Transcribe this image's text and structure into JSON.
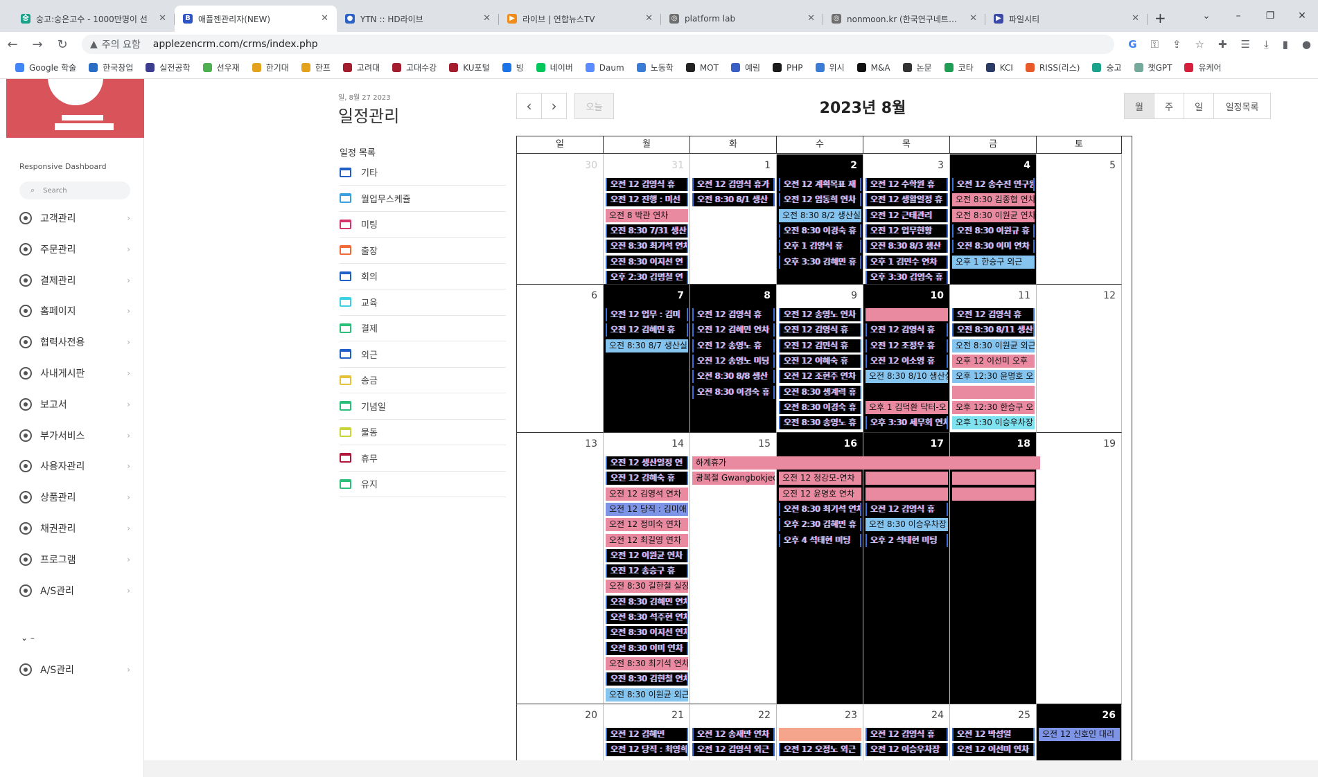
{
  "browser": {
    "tabs": [
      {
        "title": "숭고:숭은고수 - 1000만명이 선",
        "icon_color": "#1aa38b",
        "icon_glyph": "숭",
        "active": false
      },
      {
        "title": "애플젠관리자(NEW)",
        "icon_color": "#2e55c6",
        "icon_glyph": "B",
        "active": true
      },
      {
        "title": "YTN :: HD라이브",
        "icon_color": "#2a63c4",
        "icon_glyph": "●",
        "active": false
      },
      {
        "title": "라이브 | 연합뉴스TV",
        "icon_color": "#f08c1a",
        "icon_glyph": "▶",
        "active": false
      },
      {
        "title": "platform lab",
        "icon_color": "#6f6f6f",
        "icon_glyph": "◎",
        "active": false
      },
      {
        "title": "nonmoon.kr (한국연구네트워크",
        "icon_color": "#6f6f6f",
        "icon_glyph": "◎",
        "active": false
      },
      {
        "title": "파일시티",
        "icon_color": "#3b4aa7",
        "icon_glyph": "▶",
        "active": false
      }
    ],
    "new_tab": "+",
    "warning_text": "주의 요함",
    "url": "applezencrm.com/crms/index.php",
    "bookmarks": [
      {
        "label": "Google 학술",
        "color": "#4285f4"
      },
      {
        "label": "한국창업",
        "color": "#2b6cc4"
      },
      {
        "label": "실전공학",
        "color": "#3d3d8f"
      },
      {
        "label": "선우재",
        "color": "#4caf50"
      },
      {
        "label": "한기대",
        "color": "#e4a11b"
      },
      {
        "label": "한프",
        "color": "#e4a11b"
      },
      {
        "label": "고려대",
        "color": "#a31d2e"
      },
      {
        "label": "고대수강",
        "color": "#a31d2e"
      },
      {
        "label": "KU포털",
        "color": "#a31d2e"
      },
      {
        "label": "빙",
        "color": "#1b73e8"
      },
      {
        "label": "네이버",
        "color": "#03c75a"
      },
      {
        "label": "Daum",
        "color": "#5a8cff"
      },
      {
        "label": "노동학",
        "color": "#3a7bd5"
      },
      {
        "label": "MOT",
        "color": "#222222"
      },
      {
        "label": "예림",
        "color": "#3a5fc4"
      },
      {
        "label": "PHP",
        "color": "#1a1a1a"
      },
      {
        "label": "위시",
        "color": "#3a7bd5"
      },
      {
        "label": "M&A",
        "color": "#111111"
      },
      {
        "label": "논문",
        "color": "#333333"
      },
      {
        "label": "코타",
        "color": "#1f9d55"
      },
      {
        "label": "KCI",
        "color": "#2a3b66"
      },
      {
        "label": "RISS(리스)",
        "color": "#e85a2a"
      },
      {
        "label": "숭고",
        "color": "#1aa38b"
      },
      {
        "label": "챗GPT",
        "color": "#74aa9c"
      },
      {
        "label": "유케어",
        "color": "#d6203b"
      }
    ]
  },
  "sidebar": {
    "title": "Responsive Dashboard",
    "search_placeholder": "Search",
    "menu": [
      "고객관리",
      "주문관리",
      "결제관리",
      "홈페이지",
      "협력사전용",
      "사내게시판",
      "보고서",
      "부가서비스",
      "사용자관리",
      "상품관리",
      "채권관리",
      "프로그램",
      "A/S관리"
    ],
    "mini_row": "⌄        –",
    "extra_item": "A/S관리"
  },
  "page": {
    "date": "일, 8월 27 2023",
    "title": "일정관리",
    "category_title": "일정 목록",
    "categories": [
      {
        "label": "기타",
        "color": "#1f5fc7"
      },
      {
        "label": "월업무스케쥴",
        "color": "#3aa0e0"
      },
      {
        "label": "미팅",
        "color": "#d6336c"
      },
      {
        "label": "출장",
        "color": "#f06a3a"
      },
      {
        "label": "회의",
        "color": "#1f5fc7"
      },
      {
        "label": "교육",
        "color": "#3ad0e6"
      },
      {
        "label": "결제",
        "color": "#2cbf7a"
      },
      {
        "label": "외근",
        "color": "#1f5fc7"
      },
      {
        "label": "송금",
        "color": "#e6c23a"
      },
      {
        "label": "기념일",
        "color": "#2cbf7a"
      },
      {
        "label": "물동",
        "color": "#c8d43a"
      },
      {
        "label": "휴무",
        "color": "#b0173a"
      },
      {
        "label": "유지",
        "color": "#2cbf7a"
      }
    ]
  },
  "calendar": {
    "prev": "‹",
    "next": "›",
    "today": "오늘",
    "title": "2023년 8월",
    "views": [
      "월",
      "주",
      "일",
      "일정목록"
    ],
    "weekdays": [
      "일",
      "월",
      "화",
      "수",
      "목",
      "금",
      "토"
    ],
    "weeks": [
      {
        "days": [
          {
            "num": "30",
            "other": true,
            "dark": false,
            "events": []
          },
          {
            "num": "31",
            "other": true,
            "dark": false,
            "events": [
              {
                "text": "오전 12 김영식 휴",
                "style": "glitch"
              },
              {
                "text": "오전 12 진행 : 미선",
                "style": "glitch"
              },
              {
                "text": "오전 8 박관 연차",
                "style": "pink"
              },
              {
                "text": "오전 8:30 7/31 생산",
                "style": "glitch"
              },
              {
                "text": "오전 8:30 최기석 연차",
                "style": "glitch"
              },
              {
                "text": "오전 8:30 이지선 연",
                "style": "glitch"
              },
              {
                "text": "오후 2:30 김명철 연",
                "style": "glitch"
              }
            ]
          },
          {
            "num": "1",
            "other": false,
            "dark": false,
            "events": [
              {
                "text": "오전 12 김영식 휴가",
                "style": "glitch"
              },
              {
                "text": "오전 8:30 8/1 생산",
                "style": "glitch"
              }
            ]
          },
          {
            "num": "2",
            "other": false,
            "dark": true,
            "events": [
              {
                "text": "오전 12 계획목표 재",
                "style": "glitch"
              },
              {
                "text": "오전 12 임동희 연차",
                "style": "glitch"
              },
              {
                "text": "오전 8:30 8/2 생산실",
                "style": "blue"
              },
              {
                "text": "오전 8:30 이경숙 휴",
                "style": "glitch"
              },
              {
                "text": "오후 1 김영식 휴",
                "style": "glitch"
              },
              {
                "text": "오후 3:30 김혜민 휴",
                "style": "glitch"
              }
            ]
          },
          {
            "num": "3",
            "other": false,
            "dark": false,
            "events": [
              {
                "text": "오전 12 수학원 휴",
                "style": "glitch"
              },
              {
                "text": "오전 12 생활일정 휴",
                "style": "glitch"
              },
              {
                "text": "오전 12 근태관리",
                "style": "glitch"
              },
              {
                "text": "오전 12 업무현황",
                "style": "glitch"
              },
              {
                "text": "오전 8:30 8/3 생산",
                "style": "glitch"
              },
              {
                "text": "오후 1 김민수 연차",
                "style": "glitch"
              },
              {
                "text": "오후 3:30 김영숙 휴",
                "style": "glitch"
              }
            ]
          },
          {
            "num": "4",
            "other": false,
            "dark": true,
            "events": [
              {
                "text": "오전 12 송수진 연구원",
                "style": "glitch"
              },
              {
                "text": "오전 8:30 김종협 연차",
                "style": "pink"
              },
              {
                "text": "오전 8:30 이원균 연차",
                "style": "pink"
              },
              {
                "text": "오전 8:30 이원규 휴",
                "style": "glitch"
              },
              {
                "text": "오전 8:30 이미 연차",
                "style": "glitch"
              },
              {
                "text": "오후 1 한승구 외근",
                "style": "blue"
              }
            ]
          },
          {
            "num": "5",
            "other": false,
            "dark": false,
            "events": []
          }
        ]
      },
      {
        "days": [
          {
            "num": "6",
            "other": false,
            "dark": false,
            "events": []
          },
          {
            "num": "7",
            "other": false,
            "dark": true,
            "events": [
              {
                "text": "오전 12 업무 : 김미",
                "style": "glitch"
              },
              {
                "text": "오전 12 김혜민 휴",
                "style": "glitch"
              },
              {
                "text": "오전 8:30 8/7 생산실",
                "style": "blue"
              }
            ]
          },
          {
            "num": "8",
            "other": false,
            "dark": true,
            "events": [
              {
                "text": "오전 12 김영식 휴",
                "style": "glitch"
              },
              {
                "text": "오전 12 김혜민 연차",
                "style": "glitch"
              },
              {
                "text": "오전 12 송영노 휴",
                "style": "glitch"
              },
              {
                "text": "오전 12 송영노 미팅",
                "style": "glitch"
              },
              {
                "text": "오전 8:30 8/8 생산",
                "style": "glitch"
              },
              {
                "text": "오전 8:30 이경숙 휴",
                "style": "glitch"
              }
            ]
          },
          {
            "num": "9",
            "other": false,
            "dark": false,
            "events": [
              {
                "text": "오전 12 송영노 연차",
                "style": "glitch"
              },
              {
                "text": "오전 12 김영식 휴",
                "style": "glitch"
              },
              {
                "text": "오전 12 김민식 휴",
                "style": "glitch"
              },
              {
                "text": "오전 12 이혜숙 휴",
                "style": "glitch"
              },
              {
                "text": "오전 12 조현주 연차",
                "style": "glitch"
              },
              {
                "text": "오전 8:30 생계력 휴",
                "style": "glitch"
              },
              {
                "text": "오전 8:30 이경숙 휴",
                "style": "glitch"
              },
              {
                "text": "오전 8:30 송영노 휴",
                "style": "glitch"
              }
            ]
          },
          {
            "num": "10",
            "other": false,
            "dark": true,
            "events": [
              {
                "text": "",
                "style": "pink"
              },
              {
                "text": "오전 12 김영식 휴",
                "style": "glitch"
              },
              {
                "text": "오전 12 조정우 휴",
                "style": "glitch"
              },
              {
                "text": "오전 12 이소영 휴",
                "style": "glitch"
              },
              {
                "text": "오전 8:30 8/10 생산실",
                "style": "blue"
              },
              {
                "text": "",
                "style": "none"
              },
              {
                "text": "오후 1 김덕환 닥터-오",
                "style": "pink"
              },
              {
                "text": "오후 3:30 세무회 연차",
                "style": "glitch"
              }
            ]
          },
          {
            "num": "11",
            "other": false,
            "dark": false,
            "events": [
              {
                "text": "오전 12 김영식 휴",
                "style": "glitch"
              },
              {
                "text": "오전 8:30 8/11 생산",
                "style": "glitch"
              },
              {
                "text": "오전 8:30 이원균 외근",
                "style": "blue"
              },
              {
                "text": "오후 12 이선미 오후",
                "style": "pink"
              },
              {
                "text": "오후 12:30 윤명호 오",
                "style": "blue"
              },
              {
                "text": "",
                "style": "pink"
              },
              {
                "text": "오후 12:30 한승구 오",
                "style": "pink"
              },
              {
                "text": "오후 1:30 이승우차장",
                "style": "cyan"
              }
            ]
          },
          {
            "num": "12",
            "other": false,
            "dark": false,
            "events": []
          }
        ]
      },
      {
        "days": [
          {
            "num": "13",
            "other": false,
            "dark": false,
            "events": []
          },
          {
            "num": "14",
            "other": false,
            "dark": false,
            "events": [
              {
                "text": "오전 12 생산일정 연",
                "style": "glitch"
              },
              {
                "text": "오전 12 김혜숙 휴",
                "style": "glitch"
              },
              {
                "text": "오전 12 김영석 연차",
                "style": "pink"
              },
              {
                "text": "오전 12 당직 : 김미애",
                "style": "royal"
              },
              {
                "text": "오전 12 정미숙 연차",
                "style": "pink"
              },
              {
                "text": "오전 12 최길영 연차",
                "style": "pink"
              },
              {
                "text": "오전 12 이원균 연차",
                "style": "glitch"
              },
              {
                "text": "오전 12 송승구 휴",
                "style": "glitch"
              },
              {
                "text": "오전 8:30 길한철 실장",
                "style": "pink"
              },
              {
                "text": "오전 8:30 김혜민 연차",
                "style": "glitch"
              },
              {
                "text": "오전 8:30 석주현 연차",
                "style": "glitch"
              },
              {
                "text": "오전 8:30 이지선 연차",
                "style": "glitch"
              },
              {
                "text": "오전 8:30 이미 연차",
                "style": "glitch"
              },
              {
                "text": "오전 8:30 최기석 연차",
                "style": "pink"
              },
              {
                "text": "오전 8:30 김현철 연차",
                "style": "glitch"
              },
              {
                "text": "오전 8:30 이원균 외근",
                "style": "blue"
              }
            ]
          },
          {
            "num": "15",
            "other": false,
            "dark": false,
            "events": [
              {
                "text": "하계휴가",
                "style": "pink-span"
              },
              {
                "text": "광복절 Gwangbokjeo",
                "style": "pink"
              }
            ]
          },
          {
            "num": "16",
            "other": false,
            "dark": true,
            "events": [
              {
                "text": "",
                "style": "pink"
              },
              {
                "text": "오전 12 정강모-연차",
                "style": "pink"
              },
              {
                "text": "오전 12 윤명호 연차",
                "style": "pink"
              },
              {
                "text": "오전 8:30 최기석 연차",
                "style": "glitch"
              },
              {
                "text": "오후 2:30 김혜민 휴",
                "style": "glitch"
              },
              {
                "text": "오후 4 석태현 미팅",
                "style": "glitch"
              }
            ]
          },
          {
            "num": "17",
            "other": false,
            "dark": true,
            "events": [
              {
                "text": "",
                "style": "pink"
              },
              {
                "text": "",
                "style": "pink"
              },
              {
                "text": "",
                "style": "pink"
              },
              {
                "text": "오전 12 김영식 휴",
                "style": "glitch"
              },
              {
                "text": "오전 8:30 이승우차장",
                "style": "blue"
              },
              {
                "text": "오후 2 석태현 미팅",
                "style": "glitch"
              }
            ]
          },
          {
            "num": "18",
            "other": false,
            "dark": true,
            "events": [
              {
                "text": "",
                "style": "pink"
              },
              {
                "text": "",
                "style": "pink"
              },
              {
                "text": "",
                "style": "pink"
              }
            ]
          },
          {
            "num": "19",
            "other": false,
            "dark": false,
            "events": []
          }
        ]
      },
      {
        "days": [
          {
            "num": "20",
            "other": false,
            "dark": false,
            "events": []
          },
          {
            "num": "21",
            "other": false,
            "dark": false,
            "events": [
              {
                "text": "오전 12 김혜민",
                "style": "glitch"
              },
              {
                "text": "오전 12 당직 : 최영희",
                "style": "glitch"
              }
            ]
          },
          {
            "num": "22",
            "other": false,
            "dark": false,
            "events": [
              {
                "text": "오전 12 송재만 연차",
                "style": "glitch"
              },
              {
                "text": "오전 12 김영식 외근",
                "style": "glitch"
              }
            ]
          },
          {
            "num": "23",
            "other": false,
            "dark": false,
            "events": [
              {
                "text": "",
                "style": "salmon"
              },
              {
                "text": "오전 12 오정노 외근",
                "style": "glitch"
              }
            ]
          },
          {
            "num": "24",
            "other": false,
            "dark": false,
            "events": [
              {
                "text": "오전 12 김영식 휴",
                "style": "glitch"
              },
              {
                "text": "오전 12 이승우차장",
                "style": "glitch"
              }
            ]
          },
          {
            "num": "25",
            "other": false,
            "dark": false,
            "events": [
              {
                "text": "오전 12 박성일",
                "style": "glitch"
              },
              {
                "text": "오전 12 이선미 연차",
                "style": "glitch"
              }
            ]
          },
          {
            "num": "26",
            "other": false,
            "dark": true,
            "events": [
              {
                "text": "오전 12 신호인 대리",
                "style": "royal"
              }
            ]
          }
        ]
      }
    ]
  }
}
